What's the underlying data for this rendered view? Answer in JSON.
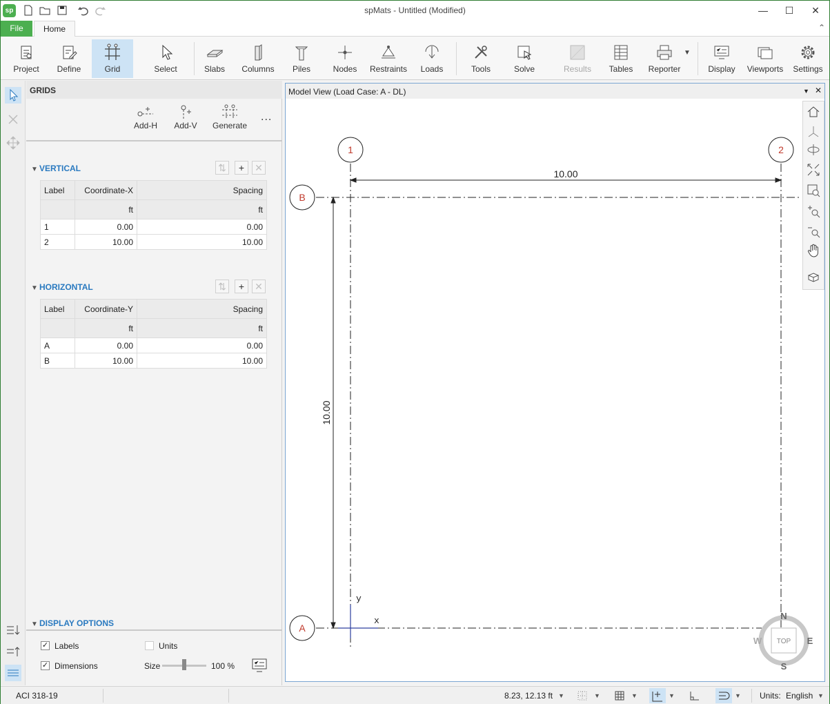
{
  "app": {
    "logo": "sp",
    "title": "spMats - Untitled (Modified)"
  },
  "window_controls": {
    "minimize": "—",
    "maximize": "☐",
    "close": "✕"
  },
  "tabs": {
    "file": "File",
    "home": "Home"
  },
  "ribbon": {
    "project": "Project",
    "define": "Define",
    "grid": "Grid",
    "select": "Select",
    "slabs": "Slabs",
    "columns": "Columns",
    "piles": "Piles",
    "nodes": "Nodes",
    "restraints": "Restraints",
    "loads": "Loads",
    "tools": "Tools",
    "solve": "Solve",
    "results": "Results",
    "tables": "Tables",
    "reporter": "Reporter",
    "display": "Display",
    "viewports": "Viewports",
    "settings": "Settings"
  },
  "panel": {
    "title": "GRIDS",
    "tools": {
      "add_h": "Add-H",
      "add_v": "Add-V",
      "generate": "Generate",
      "more": "..."
    },
    "vertical": {
      "title": "VERTICAL",
      "headers": [
        "Label",
        "Coordinate-X",
        "Spacing"
      ],
      "units": [
        "",
        "ft",
        "ft"
      ],
      "rows": [
        {
          "label": "1",
          "coord": "0.00",
          "spacing": "0.00"
        },
        {
          "label": "2",
          "coord": "10.00",
          "spacing": "10.00"
        }
      ]
    },
    "horizontal": {
      "title": "HORIZONTAL",
      "headers": [
        "Label",
        "Coordinate-Y",
        "Spacing"
      ],
      "units": [
        "",
        "ft",
        "ft"
      ],
      "rows": [
        {
          "label": "A",
          "coord": "0.00",
          "spacing": "0.00"
        },
        {
          "label": "B",
          "coord": "10.00",
          "spacing": "10.00"
        }
      ]
    },
    "display_options": {
      "title": "DISPLAY OPTIONS",
      "labels": "Labels",
      "labels_checked": true,
      "units": "Units",
      "units_checked": false,
      "dimensions": "Dimensions",
      "dimensions_checked": true,
      "size_label": "Size",
      "size_value": "100 %",
      "size_fraction": 0.5
    }
  },
  "model_view": {
    "title": "Model View (Load Case: A - DL)",
    "grid_labels": {
      "v1": "1",
      "v2": "2",
      "hA": "A",
      "hB": "B"
    },
    "dim_horizontal": "10.00",
    "dim_vertical": "10.00",
    "axis_x": "x",
    "axis_y": "y",
    "compass": {
      "n": "N",
      "s": "S",
      "e": "E",
      "w": "W",
      "center": "TOP"
    }
  },
  "statusbar": {
    "code": "ACI 318-19",
    "coords": "8.23, 12.13 ft",
    "units_label": "Units:",
    "units_value": "English"
  },
  "colors": {
    "accent": "#4caf50",
    "link": "#2a7ac0",
    "grid_label": "#c0392b",
    "active_bg": "#cde3f5"
  }
}
